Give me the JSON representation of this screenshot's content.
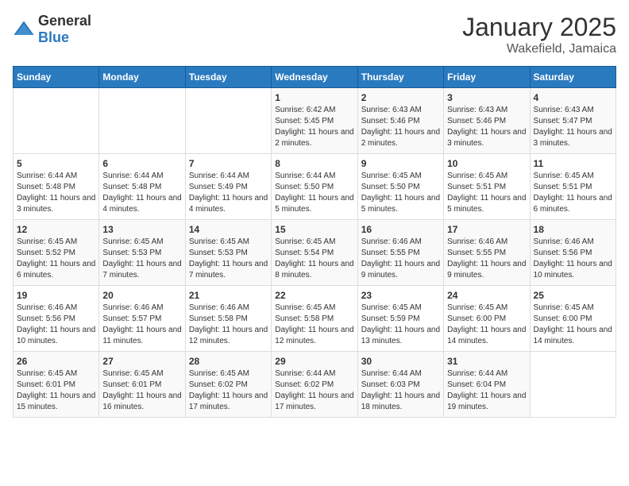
{
  "header": {
    "logo_general": "General",
    "logo_blue": "Blue",
    "month_title": "January 2025",
    "location": "Wakefield, Jamaica"
  },
  "days_of_week": [
    "Sunday",
    "Monday",
    "Tuesday",
    "Wednesday",
    "Thursday",
    "Friday",
    "Saturday"
  ],
  "weeks": [
    [
      {
        "day": "",
        "content": ""
      },
      {
        "day": "",
        "content": ""
      },
      {
        "day": "",
        "content": ""
      },
      {
        "day": "1",
        "content": "Sunrise: 6:42 AM\nSunset: 5:45 PM\nDaylight: 11 hours and 2 minutes."
      },
      {
        "day": "2",
        "content": "Sunrise: 6:43 AM\nSunset: 5:46 PM\nDaylight: 11 hours and 2 minutes."
      },
      {
        "day": "3",
        "content": "Sunrise: 6:43 AM\nSunset: 5:46 PM\nDaylight: 11 hours and 3 minutes."
      },
      {
        "day": "4",
        "content": "Sunrise: 6:43 AM\nSunset: 5:47 PM\nDaylight: 11 hours and 3 minutes."
      }
    ],
    [
      {
        "day": "5",
        "content": "Sunrise: 6:44 AM\nSunset: 5:48 PM\nDaylight: 11 hours and 3 minutes."
      },
      {
        "day": "6",
        "content": "Sunrise: 6:44 AM\nSunset: 5:48 PM\nDaylight: 11 hours and 4 minutes."
      },
      {
        "day": "7",
        "content": "Sunrise: 6:44 AM\nSunset: 5:49 PM\nDaylight: 11 hours and 4 minutes."
      },
      {
        "day": "8",
        "content": "Sunrise: 6:44 AM\nSunset: 5:50 PM\nDaylight: 11 hours and 5 minutes."
      },
      {
        "day": "9",
        "content": "Sunrise: 6:45 AM\nSunset: 5:50 PM\nDaylight: 11 hours and 5 minutes."
      },
      {
        "day": "10",
        "content": "Sunrise: 6:45 AM\nSunset: 5:51 PM\nDaylight: 11 hours and 5 minutes."
      },
      {
        "day": "11",
        "content": "Sunrise: 6:45 AM\nSunset: 5:51 PM\nDaylight: 11 hours and 6 minutes."
      }
    ],
    [
      {
        "day": "12",
        "content": "Sunrise: 6:45 AM\nSunset: 5:52 PM\nDaylight: 11 hours and 6 minutes."
      },
      {
        "day": "13",
        "content": "Sunrise: 6:45 AM\nSunset: 5:53 PM\nDaylight: 11 hours and 7 minutes."
      },
      {
        "day": "14",
        "content": "Sunrise: 6:45 AM\nSunset: 5:53 PM\nDaylight: 11 hours and 7 minutes."
      },
      {
        "day": "15",
        "content": "Sunrise: 6:45 AM\nSunset: 5:54 PM\nDaylight: 11 hours and 8 minutes."
      },
      {
        "day": "16",
        "content": "Sunrise: 6:46 AM\nSunset: 5:55 PM\nDaylight: 11 hours and 9 minutes."
      },
      {
        "day": "17",
        "content": "Sunrise: 6:46 AM\nSunset: 5:55 PM\nDaylight: 11 hours and 9 minutes."
      },
      {
        "day": "18",
        "content": "Sunrise: 6:46 AM\nSunset: 5:56 PM\nDaylight: 11 hours and 10 minutes."
      }
    ],
    [
      {
        "day": "19",
        "content": "Sunrise: 6:46 AM\nSunset: 5:56 PM\nDaylight: 11 hours and 10 minutes."
      },
      {
        "day": "20",
        "content": "Sunrise: 6:46 AM\nSunset: 5:57 PM\nDaylight: 11 hours and 11 minutes."
      },
      {
        "day": "21",
        "content": "Sunrise: 6:46 AM\nSunset: 5:58 PM\nDaylight: 11 hours and 12 minutes."
      },
      {
        "day": "22",
        "content": "Sunrise: 6:45 AM\nSunset: 5:58 PM\nDaylight: 11 hours and 12 minutes."
      },
      {
        "day": "23",
        "content": "Sunrise: 6:45 AM\nSunset: 5:59 PM\nDaylight: 11 hours and 13 minutes."
      },
      {
        "day": "24",
        "content": "Sunrise: 6:45 AM\nSunset: 6:00 PM\nDaylight: 11 hours and 14 minutes."
      },
      {
        "day": "25",
        "content": "Sunrise: 6:45 AM\nSunset: 6:00 PM\nDaylight: 11 hours and 14 minutes."
      }
    ],
    [
      {
        "day": "26",
        "content": "Sunrise: 6:45 AM\nSunset: 6:01 PM\nDaylight: 11 hours and 15 minutes."
      },
      {
        "day": "27",
        "content": "Sunrise: 6:45 AM\nSunset: 6:01 PM\nDaylight: 11 hours and 16 minutes."
      },
      {
        "day": "28",
        "content": "Sunrise: 6:45 AM\nSunset: 6:02 PM\nDaylight: 11 hours and 17 minutes."
      },
      {
        "day": "29",
        "content": "Sunrise: 6:44 AM\nSunset: 6:02 PM\nDaylight: 11 hours and 17 minutes."
      },
      {
        "day": "30",
        "content": "Sunrise: 6:44 AM\nSunset: 6:03 PM\nDaylight: 11 hours and 18 minutes."
      },
      {
        "day": "31",
        "content": "Sunrise: 6:44 AM\nSunset: 6:04 PM\nDaylight: 11 hours and 19 minutes."
      },
      {
        "day": "",
        "content": ""
      }
    ]
  ]
}
